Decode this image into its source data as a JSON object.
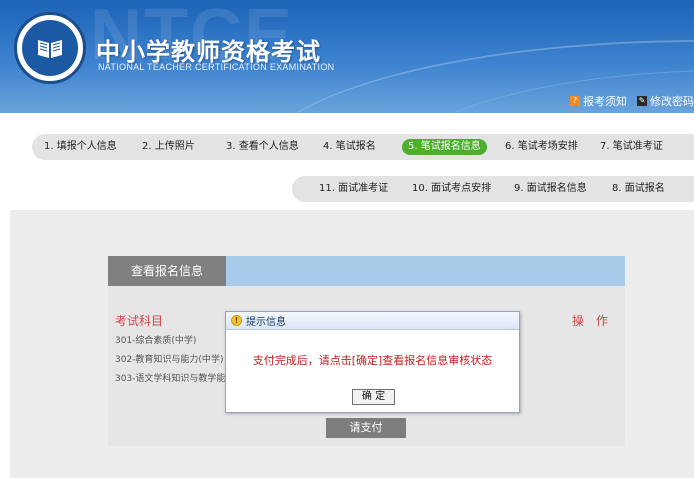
{
  "header": {
    "bg_watermark": "NTCE",
    "title_cn": "中小学教师资格考试",
    "title_en": "NATIONAL TEACHER CERTIFICATION EXAMINATION",
    "links": [
      {
        "label": "报考须知",
        "icon": "info-icon",
        "icon_char": "?"
      },
      {
        "label": "修改密码",
        "icon": "lock-icon",
        "icon_char": "✎"
      }
    ]
  },
  "steps": {
    "row1": [
      {
        "label": "1. 填报个人信息",
        "active": false
      },
      {
        "label": "2. 上传照片",
        "active": false
      },
      {
        "label": "3. 查看个人信息",
        "active": false
      },
      {
        "label": "4. 笔试报名",
        "active": false
      },
      {
        "label": "5. 笔试报名信息",
        "active": true
      },
      {
        "label": "6. 笔试考场安排",
        "active": false
      },
      {
        "label": "7. 笔试准考证",
        "active": false
      }
    ],
    "row2": [
      {
        "label": "11. 面试准考证",
        "active": false
      },
      {
        "label": "10. 面试考点安排",
        "active": false
      },
      {
        "label": "9. 面试报名信息",
        "active": false
      },
      {
        "label": "8. 面试报名",
        "active": false
      }
    ]
  },
  "panel": {
    "tab_label": "查看报名信息",
    "col_subject": "考试科目",
    "col_operation": "操 作",
    "subjects": [
      "301-综合素质(中学)",
      "302-教育知识与能力(中学)",
      "303-语文学科知识与教学能力"
    ],
    "pay_button": "请支付"
  },
  "dialog": {
    "title": "提示信息",
    "message": "支付完成后，请点击[确定]查看报名信息审核状态",
    "ok_label": "确 定"
  },
  "colors": {
    "header_blue": "#1c63b6",
    "active_step": "#4caf2e",
    "accent_red": "#d04848",
    "panel_head": "#a9cbea"
  }
}
